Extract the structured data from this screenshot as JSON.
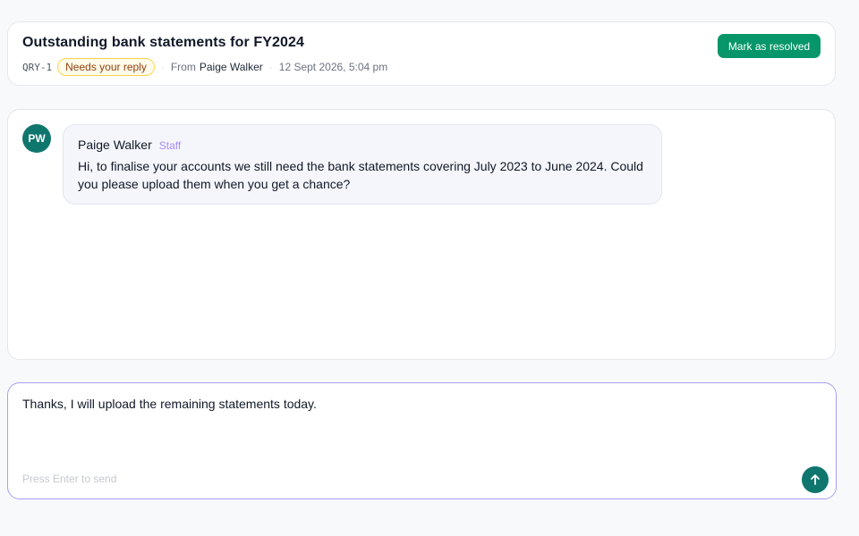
{
  "query": {
    "title": "Outstanding bank statements for FY2024",
    "ref": "QRY-1",
    "status": "Needs your reply",
    "from_label": "From",
    "from_name": "Paige Walker",
    "timestamp": "12 Sept 2026, 5:04 pm",
    "resolve_label": "Mark as resolved"
  },
  "thread": {
    "messages": [
      {
        "avatar_initials": "PW",
        "sender": "Paige Walker",
        "role": "Staff",
        "text": "Hi, to finalise your accounts we still need the bank statements covering July 2023 to June 2024. Could you please upload them when you get a chance?"
      }
    ]
  },
  "composer": {
    "value": "Thanks, I will upload the remaining statements today.",
    "hint": "Press Enter to send",
    "send_icon": "arrow-up-icon"
  },
  "colors": {
    "accent_green": "#079669",
    "avatar_teal": "#0f766e",
    "badge_bg": "#fffbeb",
    "badge_border": "#fcd34d",
    "badge_text": "#92400e",
    "role_purple": "#a78bfa",
    "composer_border": "#a5a0f5"
  }
}
